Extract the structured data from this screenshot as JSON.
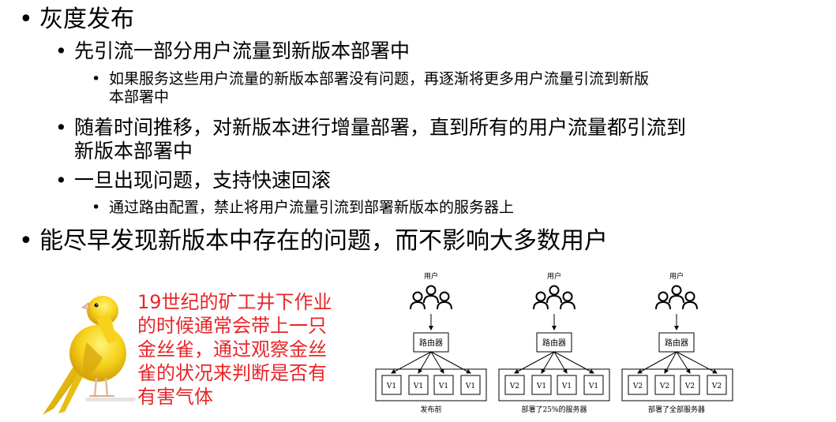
{
  "bullets": {
    "b1": "灰度发布",
    "b1_1": "先引流一部分用户流量到新版本部署中",
    "b1_1_1_line1": "如果服务这些用户流量的新版本部署没有问题，再逐渐将更多用户流量引流到新版",
    "b1_1_1_line2": "本部署中",
    "b1_2_line1": "随着时间推移，对新版本进行增量部署，直到所有的用户流量都引流到",
    "b1_2_line2": "新版本部署中",
    "b1_3": "一旦出现问题，支持快速回滚",
    "b1_3_1": "通过路由配置，禁止将用户流量引流到部署新版本的服务器上",
    "b2": "能尽早发现新版本中存在的问题，而不影响大多数用户"
  },
  "canary_note": {
    "lines": [
      "19世纪的矿工井下作业",
      "的时候通常会带上一只",
      "金丝雀，通过观察金丝",
      "雀的状况来判断是否有",
      "有害气体"
    ],
    "color": "#e8262a"
  },
  "diagrams": [
    {
      "users_label": "用户",
      "router_label": "路由器",
      "servers": [
        "V1",
        "V1",
        "V1",
        "V1"
      ],
      "caption": "发布前"
    },
    {
      "users_label": "用户",
      "router_label": "路由器",
      "servers": [
        "V2",
        "V1",
        "V1",
        "V1"
      ],
      "caption": "部署了25%的服务器"
    },
    {
      "users_label": "用户",
      "router_label": "路由器",
      "servers": [
        "V2",
        "V2",
        "V2",
        "V2"
      ],
      "caption": "部署了全部服务器"
    }
  ],
  "icons": {
    "bird": "canary-bird-icon",
    "users": "users-icon"
  }
}
